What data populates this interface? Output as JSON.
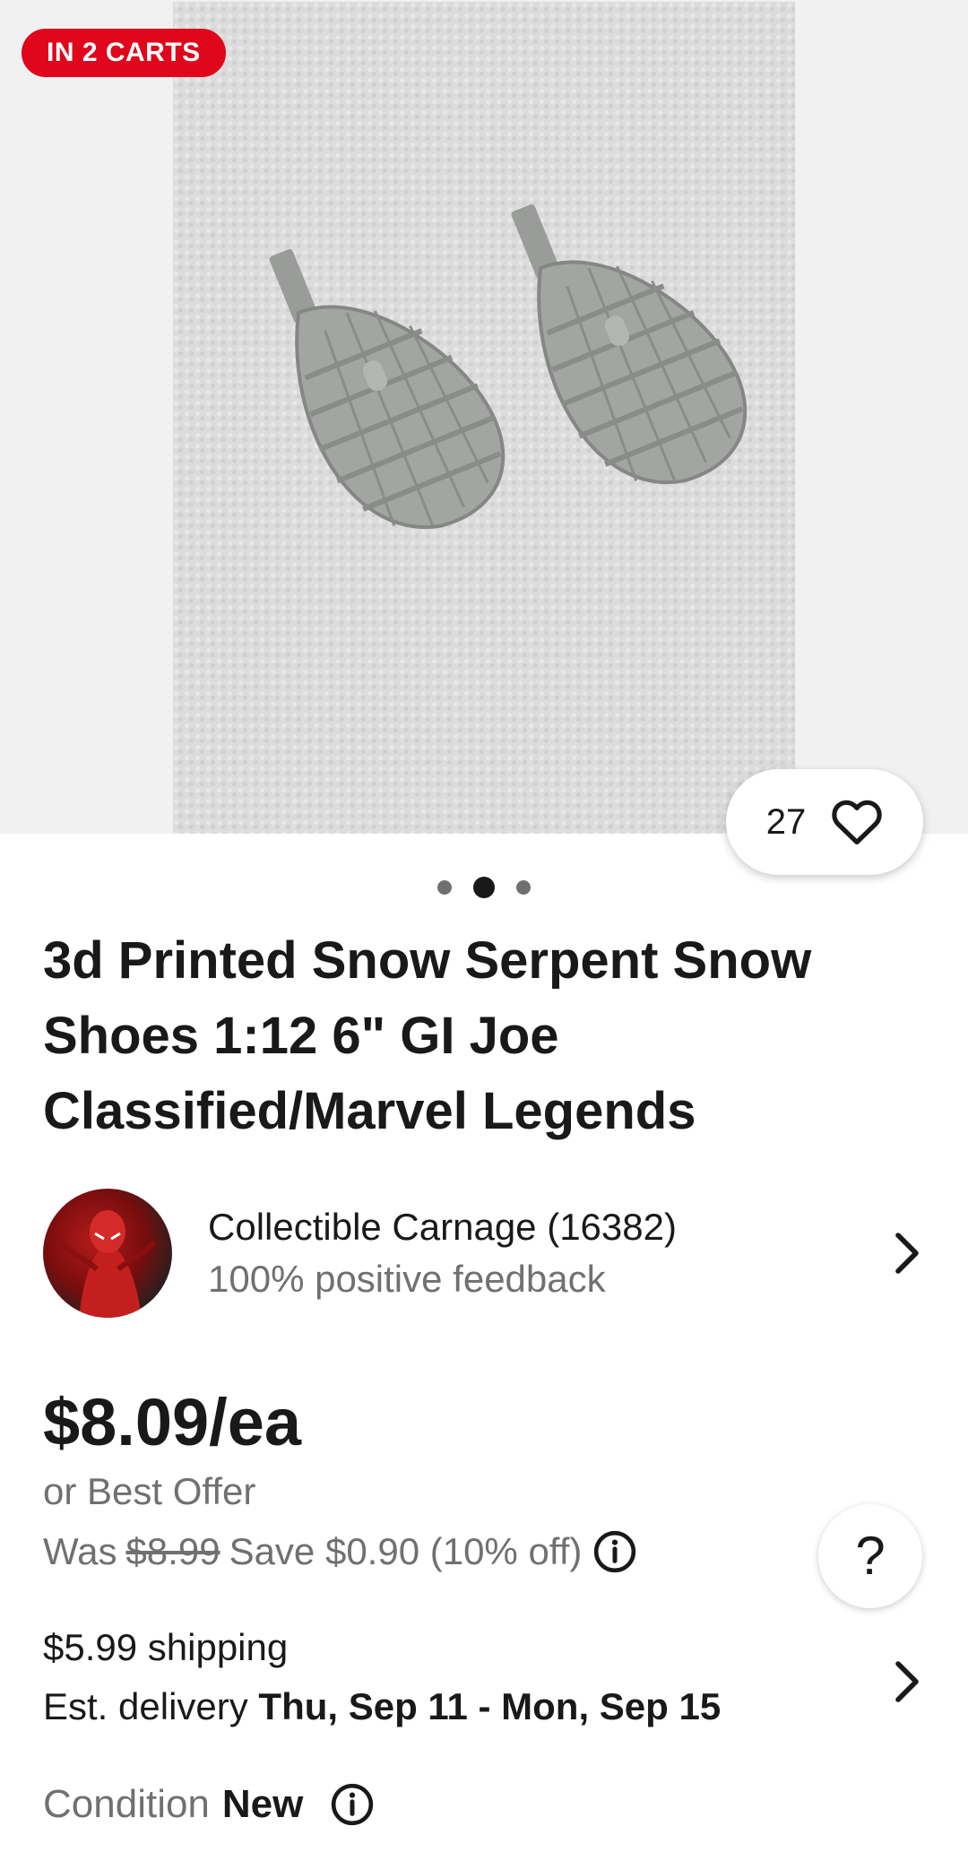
{
  "listing": {
    "badge": "IN 2 CARTS",
    "watch_count": "27",
    "image_dots": 3,
    "active_dot": 2,
    "title": "3d Printed Snow Serpent Snow Shoes 1:12 6\" GI Joe Classified/Marvel Legends"
  },
  "seller": {
    "name": "Collectible Carnage (16382)",
    "feedback": "100% positive feedback"
  },
  "pricing": {
    "price": "$8.09/ea",
    "best_offer": "or Best Offer",
    "was_label": "Was",
    "was_price": "$8.99",
    "savings": "Save $0.90 (10% off)"
  },
  "shipping": {
    "cost": "$5.99 shipping",
    "est_label": "Est. delivery",
    "est_dates": "Thu, Sep 11 - Mon, Sep 15"
  },
  "condition": {
    "label": "Condition",
    "value": "New"
  },
  "help_label": "?",
  "colors": {
    "badge_red": "#e0061b",
    "text_primary": "#191919",
    "text_secondary": "#707070"
  }
}
